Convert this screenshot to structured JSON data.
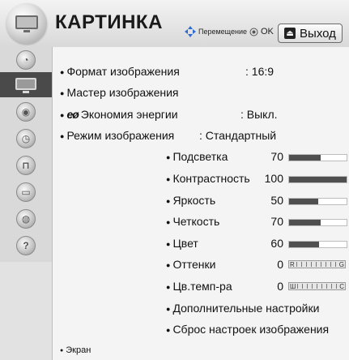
{
  "header": {
    "title": "КАРТИНКА",
    "nav_label": "Перемещение",
    "ok_label": "OK",
    "exit_label": "Выход"
  },
  "sidebar": {
    "items": [
      {
        "name": "picture",
        "icon": "tv-screen-icon",
        "active": true
      },
      {
        "name": "audio",
        "icon": "speaker-icon"
      },
      {
        "name": "time",
        "icon": "clock-icon"
      },
      {
        "name": "lock",
        "icon": "lock-icon"
      },
      {
        "name": "options",
        "icon": "briefcase-icon"
      },
      {
        "name": "network",
        "icon": "globe-icon"
      },
      {
        "name": "help",
        "icon": "question-icon"
      }
    ]
  },
  "menu": {
    "aspect_label": "Формат изображения",
    "aspect_value": ": 16:9",
    "wizard_label": "Мастер изображения",
    "energy_label": "Экономия энергии",
    "energy_value": ": Выкл.",
    "mode_label": "Режим изображения",
    "mode_value": ": Стандартный",
    "screen_label": "Экран",
    "advanced_label": "Дополнительные настройки",
    "reset_label": "Сброс настроек изображения"
  },
  "settings": [
    {
      "label": "Подсветка",
      "value": "70",
      "level": 0.55
    },
    {
      "label": "Контрастность",
      "value": "100",
      "level": 1.0
    },
    {
      "label": "Яркость",
      "value": "50",
      "level": 0.5
    },
    {
      "label": "Четкость",
      "value": "70",
      "level": 0.55
    },
    {
      "label": "Цвет",
      "value": "60",
      "level": 0.52
    }
  ],
  "balance": [
    {
      "label": "Оттенки",
      "value": "0",
      "left": "R",
      "right": "G"
    },
    {
      "label": "Цв.темп-ра",
      "value": "0",
      "left": "Ш",
      "right": "C"
    }
  ],
  "colors": {
    "panel_bg": "#f4f4f4",
    "active_item": "#4a4a4a",
    "bar_fill": "#4f4f4f"
  }
}
